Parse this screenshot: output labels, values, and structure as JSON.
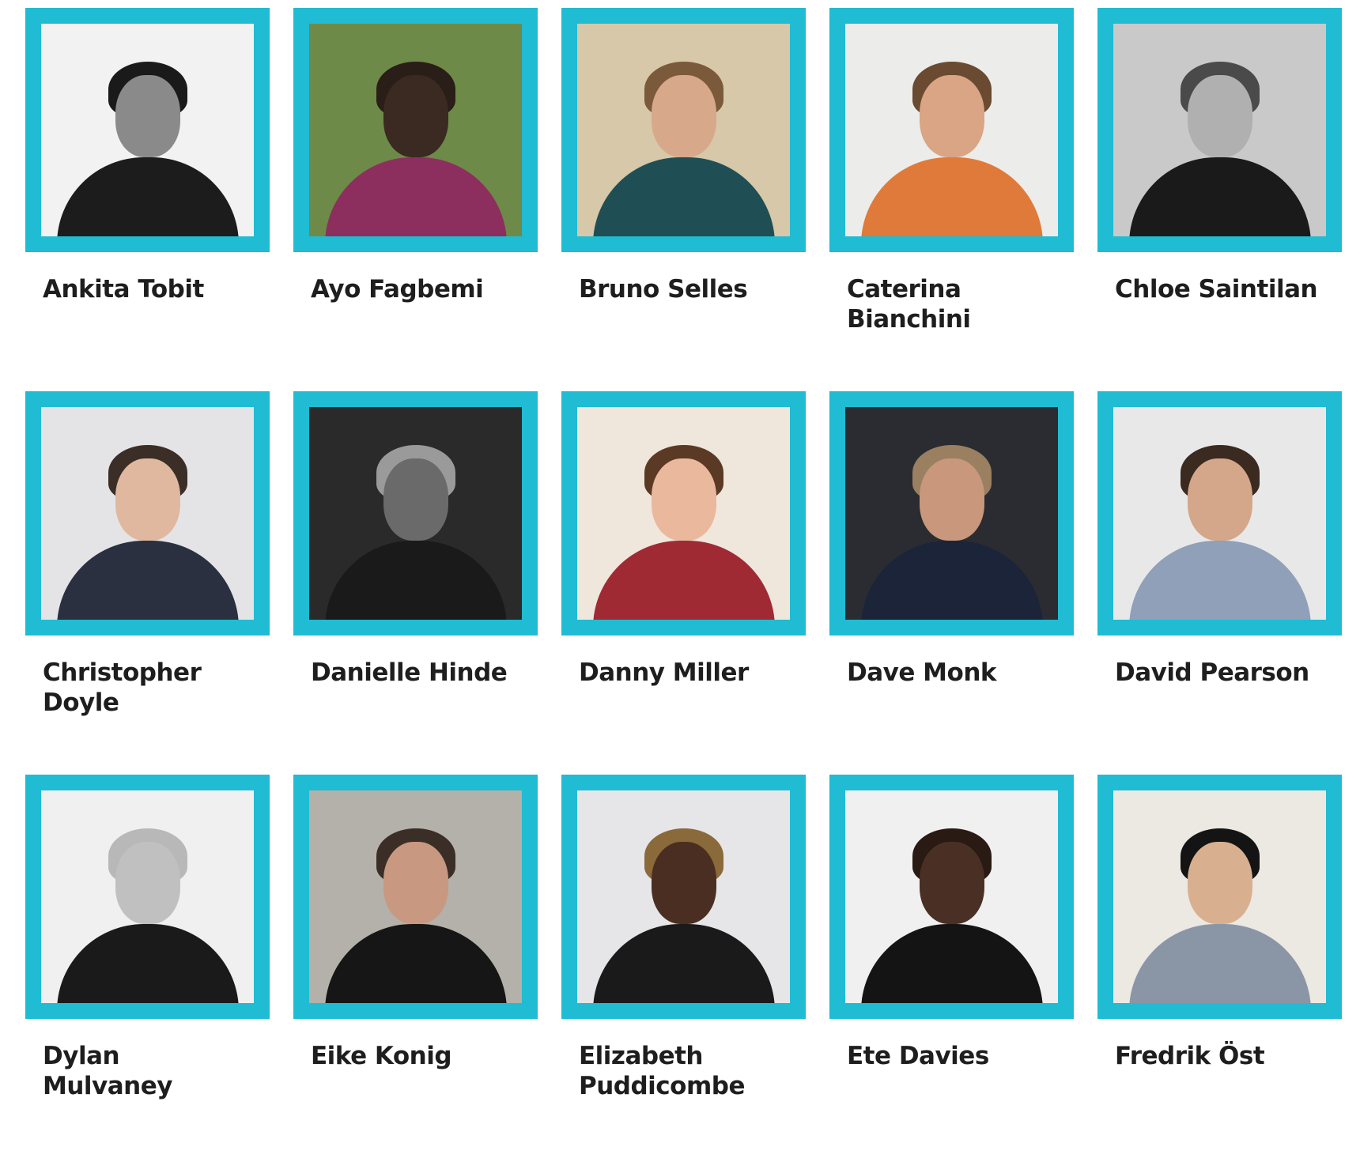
{
  "accent_color": "#1fbcd3",
  "people": [
    {
      "name": "Ankita Tobit",
      "photo": {
        "bg": "#f2f2f2",
        "skin": "#8a8a8a",
        "hair": "#1a1a1a",
        "cloth": "#1c1c1c"
      }
    },
    {
      "name": "Ayo Fagbemi",
      "photo": {
        "bg": "#6e8a48",
        "skin": "#3a2a22",
        "hair": "#2a1e18",
        "cloth": "#8c2f5e"
      }
    },
    {
      "name": "Bruno Selles",
      "photo": {
        "bg": "#d6c8a8",
        "skin": "#d8a88a",
        "hair": "#7a5a3a",
        "cloth": "#1f4f55"
      }
    },
    {
      "name": "Caterina Bianchini",
      "photo": {
        "bg": "#ececea",
        "skin": "#d9a585",
        "hair": "#6a4a30",
        "cloth": "#e07a3a"
      }
    },
    {
      "name": "Chloe Saintilan",
      "photo": {
        "bg": "#c9c9c9",
        "skin": "#b0b0b0",
        "hair": "#4a4a4a",
        "cloth": "#1a1a1a"
      }
    },
    {
      "name": "Christopher Doyle",
      "photo": {
        "bg": "#e4e4e6",
        "skin": "#e0b8a0",
        "hair": "#3a2e26",
        "cloth": "#2a3040"
      }
    },
    {
      "name": "Danielle Hinde",
      "photo": {
        "bg": "#2a2a2a",
        "skin": "#6a6a6a",
        "hair": "#9a9a9a",
        "cloth": "#1a1a1a"
      }
    },
    {
      "name": "Danny Miller",
      "photo": {
        "bg": "#efe6dc",
        "skin": "#eab89c",
        "hair": "#5a3a24",
        "cloth": "#a02a34"
      }
    },
    {
      "name": "Dave Monk",
      "photo": {
        "bg": "#2a2c32",
        "skin": "#c8977c",
        "hair": "#9a8060",
        "cloth": "#1b2438"
      }
    },
    {
      "name": "David Pearson",
      "photo": {
        "bg": "#e8e8e8",
        "skin": "#d4a68a",
        "hair": "#3a2a20",
        "cloth": "#8fa0b8"
      }
    },
    {
      "name": "Dylan Mulvaney",
      "photo": {
        "bg": "#f0f0f0",
        "skin": "#c0c0c0",
        "hair": "#b8b8b8",
        "cloth": "#1a1a1a"
      }
    },
    {
      "name": "Eike Konig",
      "photo": {
        "bg": "#b4b0aa",
        "skin": "#c89880",
        "hair": "#3a2e26",
        "cloth": "#161616"
      }
    },
    {
      "name": "Elizabeth Puddicombe",
      "photo": {
        "bg": "#e6e6e8",
        "skin": "#4a2e22",
        "hair": "#8a6a3a",
        "cloth": "#1a1a1a"
      }
    },
    {
      "name": "Ete Davies",
      "photo": {
        "bg": "#f0f0f0",
        "skin": "#4a3024",
        "hair": "#2a1a14",
        "cloth": "#141414"
      }
    },
    {
      "name": "Fredrik Öst",
      "photo": {
        "bg": "#ece8e2",
        "skin": "#d8b090",
        "hair": "#141414",
        "cloth": "#8a96a6"
      }
    }
  ]
}
